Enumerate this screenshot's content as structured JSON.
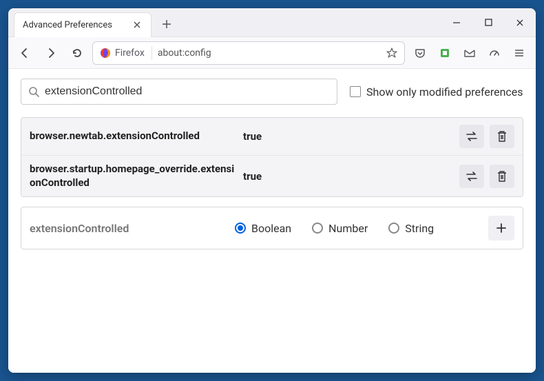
{
  "tab": {
    "title": "Advanced Preferences"
  },
  "urlbar": {
    "identity_label": "Firefox",
    "url": "about:config"
  },
  "search": {
    "value": "extensionControlled"
  },
  "show_modified_label": "Show only modified preferences",
  "prefs": [
    {
      "name": "browser.newtab.extensionControlled",
      "value": "true"
    },
    {
      "name": "browser.startup.homepage_override.extensionControlled",
      "value": "true"
    }
  ],
  "create": {
    "name": "extensionControlled",
    "types": [
      "Boolean",
      "Number",
      "String"
    ],
    "selected": "Boolean"
  }
}
